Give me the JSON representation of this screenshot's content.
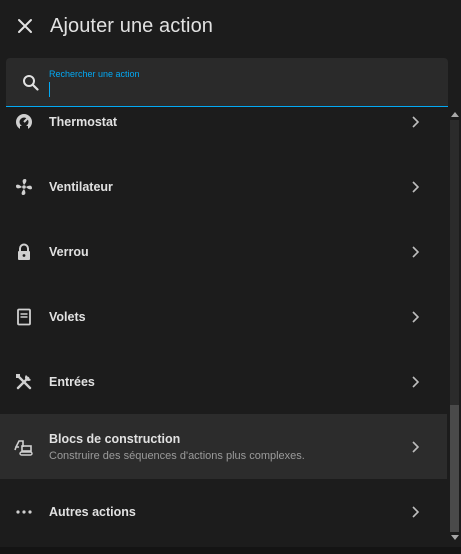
{
  "dialog": {
    "title": "Ajouter une action",
    "close_icon": "close-icon"
  },
  "search": {
    "label": "Rechercher une action",
    "value": "",
    "icon": "search-icon"
  },
  "items": [
    {
      "name": "Thermostat",
      "description": "",
      "icon": "thermostat-icon"
    },
    {
      "name": "Ventilateur",
      "description": "",
      "icon": "fan-icon"
    },
    {
      "name": "Verrou",
      "description": "",
      "icon": "lock-icon"
    },
    {
      "name": "Volets",
      "description": "",
      "icon": "window-shutter-icon"
    },
    {
      "name": "Entrées",
      "description": "",
      "icon": "tools-icon"
    },
    {
      "name": "Blocs de construction",
      "description": "Construire des séquences d'actions plus complexes.",
      "icon": "excavator-icon"
    },
    {
      "name": "Autres actions",
      "description": "",
      "icon": "dots-horizontal-icon"
    }
  ],
  "colors": {
    "background": "#1c1c1c",
    "accent": "#03a9f4",
    "text": "#e1e1e1",
    "secondary_text": "#9b9b9b",
    "selected_row": "#2c2c2c"
  }
}
